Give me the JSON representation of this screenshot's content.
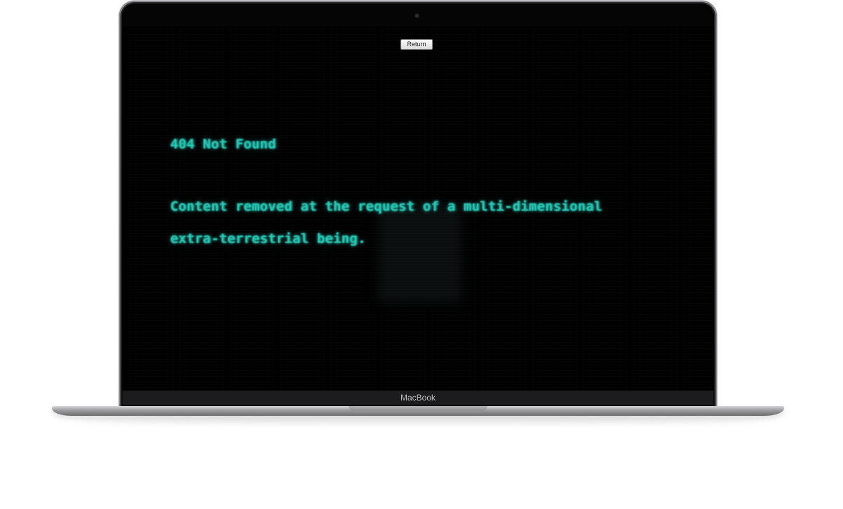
{
  "device": {
    "brand_label": "MacBook"
  },
  "page": {
    "return_button_label": "Return",
    "error_title": "404 Not Found",
    "error_message_line1": "Content removed at the request of a multi-dimensional",
    "error_message_line2": "extra-terrestrial being."
  },
  "colors": {
    "terminal_text": "#27c6b4",
    "screen_background": "#000000"
  }
}
